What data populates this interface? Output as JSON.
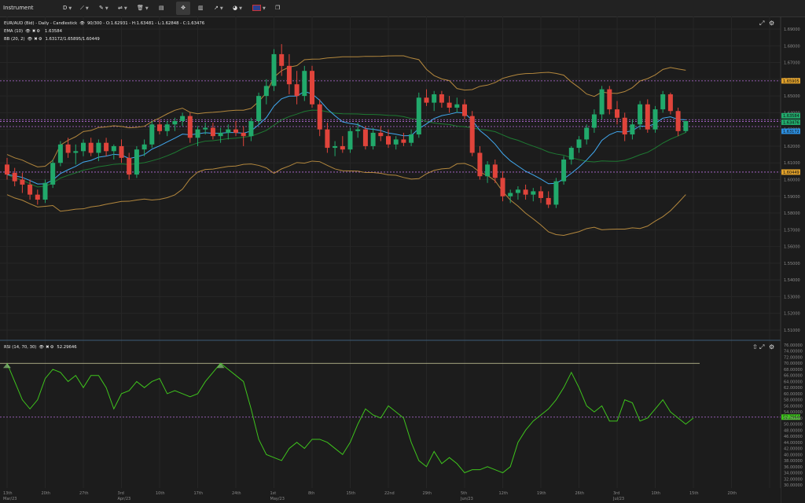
{
  "toolbar": {
    "instrument_label": "Instrument",
    "interval_label": "D",
    "icons": [
      "draw-line-icon",
      "pencil-icon",
      "compare-icon",
      "trash-icon",
      "layout-icon",
      "crosshair-icon",
      "bar-chart-icon",
      "share-icon",
      "plugin-icon",
      "flag-icon",
      "popout-icon"
    ]
  },
  "colors": {
    "background": "#1c1c1c",
    "bull": "#21a96b",
    "bear": "#e0443b",
    "ema": "#41a9f0",
    "bb_mid": "#1e7a33",
    "bb_band": "#b3873d",
    "rsi": "#3ec41c",
    "level_line": "#b56bd9"
  },
  "main": {
    "header_line1": "EUR/AUD (Bid) - Daily - Candlestick",
    "header_line1_stats": "90/300 - O:1.62931 - H:1.63481 - L:1.62848 - C:1.63476",
    "ema_label": "EMA (10)",
    "ema_value": "1.63584",
    "bb_label": "BB (20, 2)",
    "bb_value": "1.63172/1.65895/1.60449",
    "price_ticks": [
      "1.69000",
      "1.68000",
      "1.67000",
      "1.66000",
      "1.65000",
      "1.64000",
      "1.63000",
      "1.62000",
      "1.61000",
      "1.60000",
      "1.59000",
      "1.58000",
      "1.57000",
      "1.56000",
      "1.55000",
      "1.54000",
      "1.53000",
      "1.52000",
      "1.51000"
    ],
    "price_tags": [
      {
        "text": "1.65905",
        "color": "#e0a02a"
      },
      {
        "text": "1.63584",
        "color": "#21a96b"
      },
      {
        "text": "1.63476",
        "color": "#21a96b"
      },
      {
        "text": "1.63172",
        "color": "#2c8fe0"
      },
      {
        "text": "1.60449",
        "color": "#e0a02a"
      }
    ]
  },
  "rsi": {
    "label": "RSI (14, 70, 30)",
    "value": "52.29646",
    "ticks": [
      "76.00000",
      "74.00000",
      "72.00000",
      "70.00000",
      "68.00000",
      "66.00000",
      "64.00000",
      "62.00000",
      "60.00000",
      "58.00000",
      "56.00000",
      "54.00000",
      "52.00000",
      "50.00000",
      "48.00000",
      "46.00000",
      "44.00000",
      "42.00000",
      "40.00000",
      "38.00000",
      "36.00000",
      "34.00000",
      "32.00000",
      "30.00000"
    ]
  },
  "xaxis": {
    "labels": [
      {
        "a": "13th",
        "b": "Mar/23"
      },
      {
        "a": "20th",
        "b": ""
      },
      {
        "a": "27th",
        "b": ""
      },
      {
        "a": "3rd",
        "b": "Apr/23"
      },
      {
        "a": "10th",
        "b": ""
      },
      {
        "a": "17th",
        "b": ""
      },
      {
        "a": "24th",
        "b": ""
      },
      {
        "a": "1st",
        "b": "May/23"
      },
      {
        "a": "8th",
        "b": ""
      },
      {
        "a": "15th",
        "b": ""
      },
      {
        "a": "22nd",
        "b": ""
      },
      {
        "a": "29th",
        "b": ""
      },
      {
        "a": "5th",
        "b": "Jun/23"
      },
      {
        "a": "12th",
        "b": ""
      },
      {
        "a": "19th",
        "b": ""
      },
      {
        "a": "26th",
        "b": ""
      },
      {
        "a": "3rd",
        "b": "Jul/23"
      },
      {
        "a": "10th",
        "b": ""
      },
      {
        "a": "15th",
        "b": ""
      },
      {
        "a": "20th",
        "b": ""
      }
    ]
  },
  "chart_data": [
    {
      "type": "candlestick",
      "title": "EUR/AUD (Bid) - Daily - Candlestick",
      "ylim": [
        1.505,
        1.695
      ],
      "levels": [
        1.65905,
        1.63584,
        1.63476,
        1.63172,
        1.60449
      ],
      "ohlc": [
        [
          1.609,
          1.613,
          1.6,
          1.603
        ],
        [
          1.604,
          1.607,
          1.596,
          1.599
        ],
        [
          1.6,
          1.604,
          1.592,
          1.597
        ],
        [
          1.597,
          1.6,
          1.588,
          1.591
        ],
        [
          1.591,
          1.594,
          1.585,
          1.588
        ],
        [
          1.588,
          1.6,
          1.586,
          1.598
        ],
        [
          1.597,
          1.612,
          1.595,
          1.61
        ],
        [
          1.61,
          1.623,
          1.608,
          1.621
        ],
        [
          1.621,
          1.625,
          1.613,
          1.616
        ],
        [
          1.616,
          1.621,
          1.609,
          1.617
        ],
        [
          1.617,
          1.624,
          1.614,
          1.622
        ],
        [
          1.622,
          1.625,
          1.614,
          1.616
        ],
        [
          1.616,
          1.624,
          1.611,
          1.622
        ],
        [
          1.622,
          1.625,
          1.614,
          1.617
        ],
        [
          1.617,
          1.621,
          1.612,
          1.62
        ],
        [
          1.62,
          1.624,
          1.61,
          1.613
        ],
        [
          1.613,
          1.616,
          1.6,
          1.603
        ],
        [
          1.603,
          1.62,
          1.601,
          1.618
        ],
        [
          1.618,
          1.624,
          1.614,
          1.621
        ],
        [
          1.621,
          1.635,
          1.619,
          1.633
        ],
        [
          1.633,
          1.636,
          1.627,
          1.629
        ],
        [
          1.629,
          1.635,
          1.626,
          1.633
        ],
        [
          1.633,
          1.637,
          1.629,
          1.635
        ],
        [
          1.635,
          1.64,
          1.632,
          1.638
        ],
        [
          1.638,
          1.64,
          1.622,
          1.625
        ],
        [
          1.625,
          1.632,
          1.62,
          1.63
        ],
        [
          1.63,
          1.634,
          1.627,
          1.631
        ],
        [
          1.631,
          1.634,
          1.624,
          1.626
        ],
        [
          1.626,
          1.631,
          1.622,
          1.628
        ],
        [
          1.628,
          1.633,
          1.624,
          1.63
        ],
        [
          1.63,
          1.635,
          1.626,
          1.628
        ],
        [
          1.628,
          1.632,
          1.62,
          1.626
        ],
        [
          1.626,
          1.637,
          1.623,
          1.635
        ],
        [
          1.635,
          1.652,
          1.633,
          1.65
        ],
        [
          1.65,
          1.66,
          1.645,
          1.656
        ],
        [
          1.656,
          1.678,
          1.653,
          1.675
        ],
        [
          1.675,
          1.681,
          1.662,
          1.668
        ],
        [
          1.668,
          1.675,
          1.651,
          1.657
        ],
        [
          1.657,
          1.665,
          1.645,
          1.65
        ],
        [
          1.65,
          1.668,
          1.647,
          1.665
        ],
        [
          1.665,
          1.668,
          1.643,
          1.645
        ],
        [
          1.645,
          1.648,
          1.626,
          1.63
        ],
        [
          1.63,
          1.634,
          1.616,
          1.619
        ],
        [
          1.619,
          1.623,
          1.614,
          1.62
        ],
        [
          1.62,
          1.626,
          1.616,
          1.618
        ],
        [
          1.618,
          1.631,
          1.616,
          1.629
        ],
        [
          1.629,
          1.634,
          1.625,
          1.63
        ],
        [
          1.63,
          1.632,
          1.618,
          1.62
        ],
        [
          1.62,
          1.631,
          1.618,
          1.628
        ],
        [
          1.628,
          1.632,
          1.623,
          1.626
        ],
        [
          1.626,
          1.63,
          1.619,
          1.621
        ],
        [
          1.621,
          1.626,
          1.618,
          1.624
        ],
        [
          1.624,
          1.628,
          1.62,
          1.622
        ],
        [
          1.622,
          1.63,
          1.62,
          1.627
        ],
        [
          1.627,
          1.652,
          1.625,
          1.649
        ],
        [
          1.649,
          1.654,
          1.644,
          1.646
        ],
        [
          1.646,
          1.653,
          1.641,
          1.651
        ],
        [
          1.651,
          1.653,
          1.643,
          1.646
        ],
        [
          1.646,
          1.65,
          1.64,
          1.643
        ],
        [
          1.643,
          1.649,
          1.64,
          1.645
        ],
        [
          1.645,
          1.648,
          1.636,
          1.638
        ],
        [
          1.638,
          1.641,
          1.614,
          1.616
        ],
        [
          1.616,
          1.62,
          1.6,
          1.602
        ],
        [
          1.602,
          1.611,
          1.598,
          1.609
        ],
        [
          1.609,
          1.612,
          1.598,
          1.601
        ],
        [
          1.601,
          1.605,
          1.587,
          1.59
        ],
        [
          1.59,
          1.594,
          1.586,
          1.592
        ],
        [
          1.592,
          1.596,
          1.588,
          1.594
        ],
        [
          1.594,
          1.597,
          1.588,
          1.591
        ],
        [
          1.591,
          1.595,
          1.587,
          1.593
        ],
        [
          1.593,
          1.596,
          1.586,
          1.589
        ],
        [
          1.589,
          1.593,
          1.583,
          1.585
        ],
        [
          1.585,
          1.601,
          1.583,
          1.599
        ],
        [
          1.599,
          1.614,
          1.597,
          1.612
        ],
        [
          1.612,
          1.62,
          1.609,
          1.619
        ],
        [
          1.619,
          1.626,
          1.616,
          1.624
        ],
        [
          1.624,
          1.633,
          1.621,
          1.631
        ],
        [
          1.631,
          1.642,
          1.628,
          1.639
        ],
        [
          1.639,
          1.656,
          1.636,
          1.654
        ],
        [
          1.654,
          1.656,
          1.639,
          1.642
        ],
        [
          1.642,
          1.647,
          1.633,
          1.637
        ],
        [
          1.637,
          1.64,
          1.623,
          1.627
        ],
        [
          1.627,
          1.636,
          1.624,
          1.633
        ],
        [
          1.633,
          1.647,
          1.63,
          1.645
        ],
        [
          1.645,
          1.648,
          1.628,
          1.63
        ],
        [
          1.63,
          1.644,
          1.628,
          1.642
        ],
        [
          1.642,
          1.653,
          1.64,
          1.651
        ],
        [
          1.651,
          1.652,
          1.639,
          1.641
        ],
        [
          1.641,
          1.643,
          1.626,
          1.629
        ],
        [
          1.629,
          1.635,
          1.628,
          1.635
        ]
      ]
    },
    {
      "type": "line",
      "title": "RSI (14, 70, 30)",
      "ylim": [
        30,
        76
      ],
      "levels": [
        70,
        52.29646
      ],
      "values": [
        70,
        64,
        58,
        55,
        58,
        65,
        68,
        67,
        64,
        66,
        62,
        66,
        66,
        62,
        55,
        60,
        61,
        64,
        62,
        64,
        65,
        60,
        61,
        60,
        59,
        60,
        64,
        67,
        70,
        68,
        66,
        64,
        55,
        45,
        40,
        39,
        38,
        42,
        44,
        42,
        45,
        45,
        44,
        42,
        40,
        44,
        50,
        55,
        53,
        52,
        56,
        54,
        52,
        44,
        38,
        36,
        41,
        37,
        39,
        37,
        34,
        35,
        35,
        36,
        35,
        34,
        36,
        44,
        48,
        51,
        53,
        55,
        58,
        62,
        67,
        62,
        56,
        54,
        56,
        51,
        51,
        58,
        57,
        51,
        52,
        55,
        58,
        54,
        52,
        50,
        52
      ]
    }
  ]
}
